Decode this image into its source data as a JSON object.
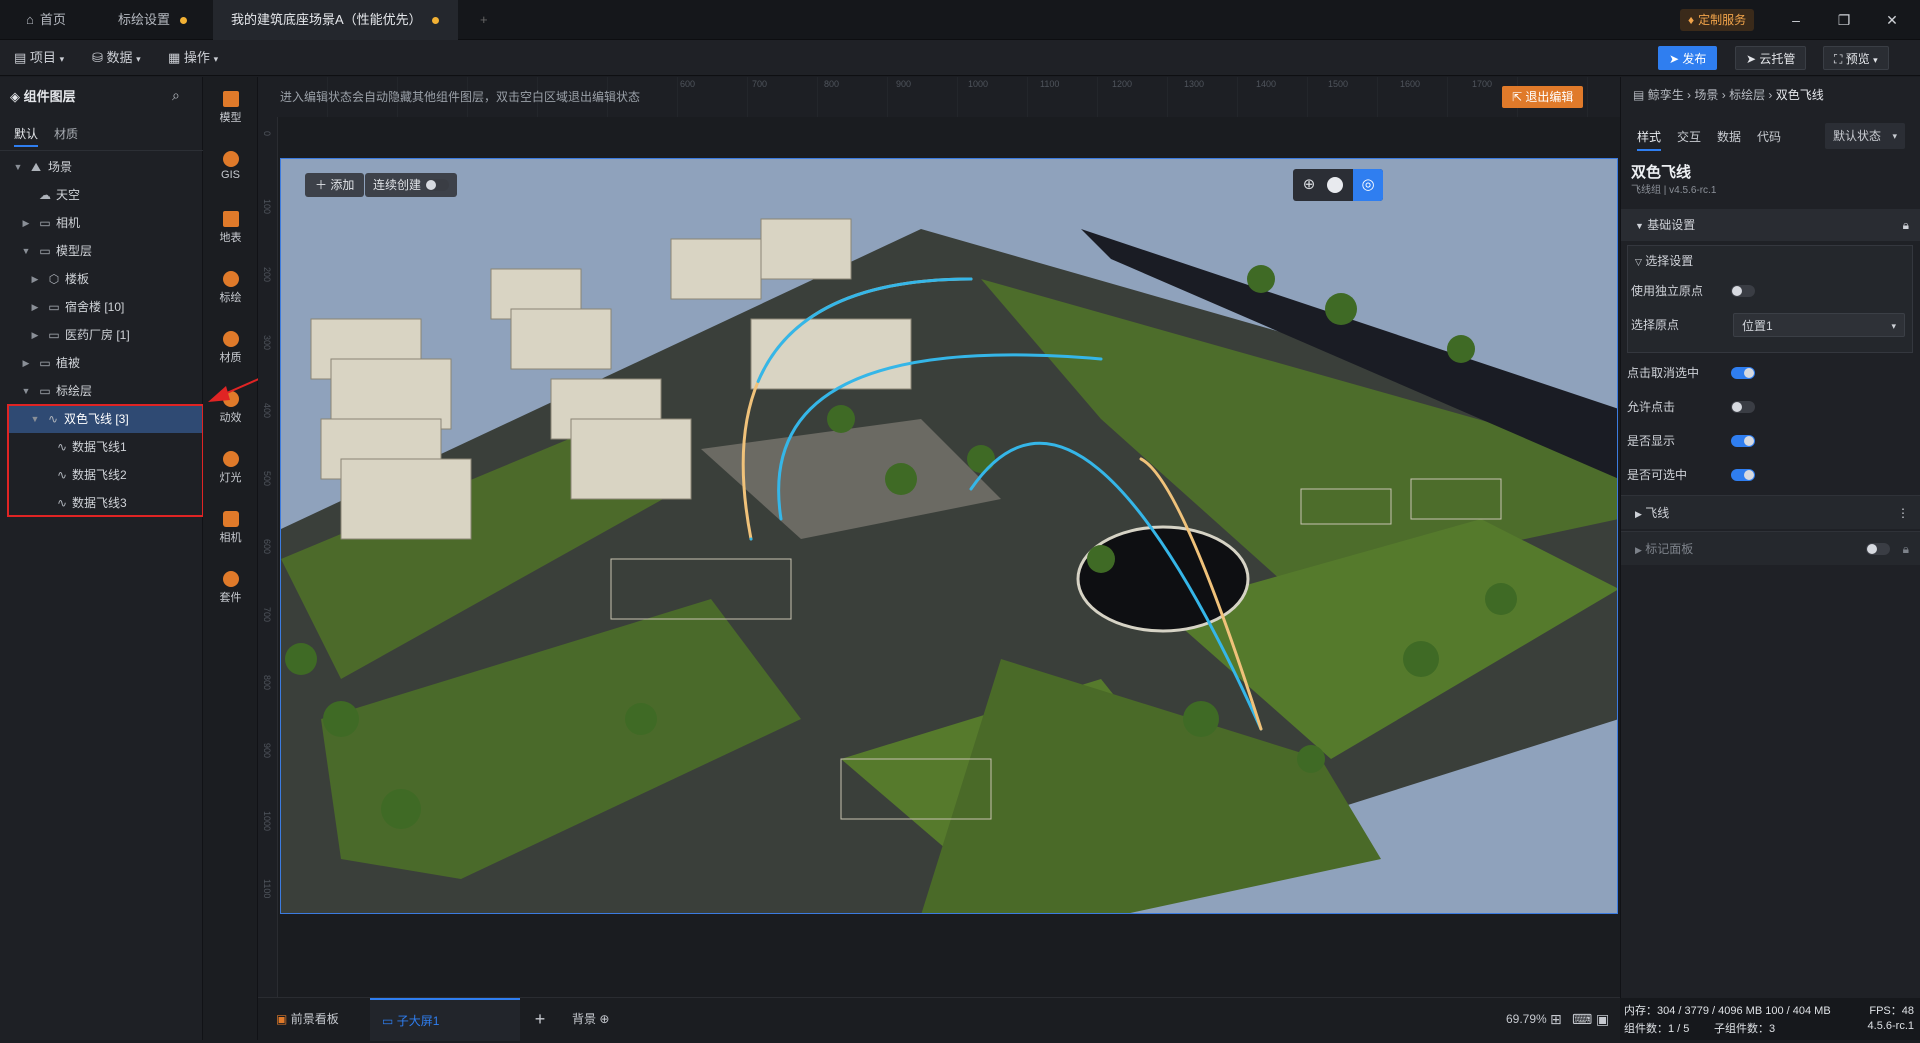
{
  "tabs": [
    {
      "label": "首页"
    },
    {
      "label": "标绘设置",
      "modified": true
    },
    {
      "label": "我的建筑底座场景A（性能优先）",
      "modified": true
    }
  ],
  "titlebar": {
    "custom_service": "定制服务"
  },
  "menu": {
    "project": "项目",
    "data": "数据",
    "operate": "操作"
  },
  "toolbar": {
    "publish": "发布",
    "cloud": "云托管",
    "preview": "预览"
  },
  "left_panel": {
    "title": "组件图层",
    "tabs": [
      "默认",
      "材质"
    ],
    "tree": [
      {
        "label": "场景"
      },
      {
        "label": "天空"
      },
      {
        "label": "相机"
      },
      {
        "label": "模型层"
      },
      {
        "label": "楼板"
      },
      {
        "label": "宿舍楼 [10]"
      },
      {
        "label": "医药厂房 [1]"
      },
      {
        "label": "植被"
      },
      {
        "label": "标绘层"
      },
      {
        "label": "双色飞线 [3]"
      },
      {
        "label": "数据飞线1"
      },
      {
        "label": "数据飞线2"
      },
      {
        "label": "数据飞线3"
      }
    ]
  },
  "icon_column": [
    {
      "label": "模型"
    },
    {
      "label": "GIS"
    },
    {
      "label": "地表"
    },
    {
      "label": "标绘"
    },
    {
      "label": "材质"
    },
    {
      "label": "动效"
    },
    {
      "label": "灯光"
    },
    {
      "label": "相机"
    },
    {
      "label": "套件"
    }
  ],
  "canvas": {
    "hint": "进入编辑状态会自动隐藏其他组件图层，双击空白区域退出编辑状态",
    "exit_edit": "退出编辑",
    "add_button": "添加",
    "continuous_create": "连续创建",
    "ruler_top": [
      "600",
      "700",
      "800",
      "900",
      "1000",
      "1100",
      "1200",
      "1300",
      "1400",
      "1500",
      "1600",
      "1700"
    ],
    "ruler_left": [
      "0",
      "100",
      "200",
      "300",
      "400",
      "500",
      "600",
      "700",
      "800",
      "900",
      "1000",
      "1100"
    ]
  },
  "bottom_tabs": [
    {
      "label": "前景看板"
    },
    {
      "label": "子大屏1"
    },
    {
      "label": "背景"
    }
  ],
  "zoom": "69.79%",
  "right_panel": {
    "breadcrumb": [
      "鲸孪生",
      "场景",
      "标绘层",
      "双色飞线"
    ],
    "tabs": [
      "样式",
      "交互",
      "数据",
      "代码"
    ],
    "state_select": "默认状态",
    "component_name": "双色飞线",
    "component_sub": "飞线组 | v4.5.6-rc.1",
    "section_basic": "基础设置",
    "section_select": "选择设置",
    "use_origin_label": "使用独立原点",
    "select_origin_label": "选择原点",
    "select_origin_value": "位置1",
    "cancel_select_label": "点击取消选中",
    "allow_click_label": "允许点击",
    "show_label": "是否显示",
    "selectable_label": "是否可选中",
    "fly_section": "飞线",
    "marker_panel": "标记面板"
  },
  "status": {
    "memory": "内存：304 / 3779 / 4096 MB 100 / 404 MB",
    "fps": "FPS：48",
    "components": "组件数：1 / 5",
    "sub_components": "子组件数：3",
    "version": "4.5.6-rc.1"
  },
  "colors": {
    "accent": "#2f7ef0",
    "highlight_border": "#e02424",
    "orange": "#e07a2a"
  }
}
